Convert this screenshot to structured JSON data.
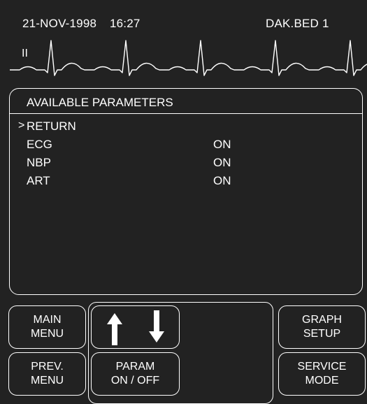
{
  "header": {
    "date": "21-NOV-1998",
    "time": "16:27",
    "bed": "DAK.BED 1"
  },
  "waveform": {
    "lead": "II"
  },
  "panel": {
    "title": "AVAILABLE PARAMETERS",
    "cursor": ">",
    "items": [
      {
        "label": "RETURN",
        "value": ""
      },
      {
        "label": "ECG",
        "value": "ON"
      },
      {
        "label": "NBP",
        "value": "ON"
      },
      {
        "label": "ART",
        "value": "ON"
      }
    ]
  },
  "softkeys": {
    "main_menu": [
      "MAIN",
      "MENU"
    ],
    "prev_menu": [
      "PREV.",
      "MENU"
    ],
    "param_on_off": [
      "PARAM",
      "ON / OFF"
    ],
    "graph_setup": [
      "GRAPH",
      "SETUP"
    ],
    "service_mode": [
      "SERVICE",
      "MODE"
    ],
    "arrows": [
      "arrow-up-icon",
      "arrow-down-icon"
    ]
  },
  "colors": {
    "background": "#222222",
    "foreground": "#ffffff"
  }
}
